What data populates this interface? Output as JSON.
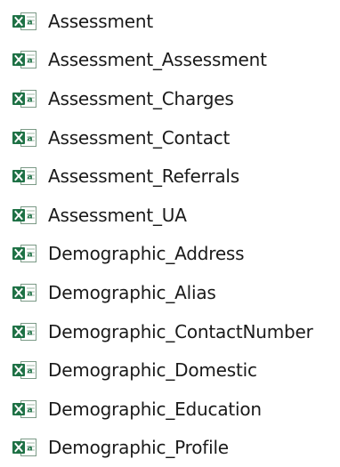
{
  "icon": {
    "name": "excel-file-icon",
    "accent": "#1e7145",
    "sheet": "#ffffff",
    "sheet_border": "#7b9a86"
  },
  "files": [
    {
      "label": "Assessment"
    },
    {
      "label": "Assessment_Assessment"
    },
    {
      "label": "Assessment_Charges"
    },
    {
      "label": "Assessment_Contact"
    },
    {
      "label": "Assessment_Referrals"
    },
    {
      "label": "Assessment_UA"
    },
    {
      "label": "Demographic_Address"
    },
    {
      "label": "Demographic_Alias"
    },
    {
      "label": "Demographic_ContactNumber"
    },
    {
      "label": "Demographic_Domestic"
    },
    {
      "label": "Demographic_Education"
    },
    {
      "label": "Demographic_Profile"
    }
  ]
}
